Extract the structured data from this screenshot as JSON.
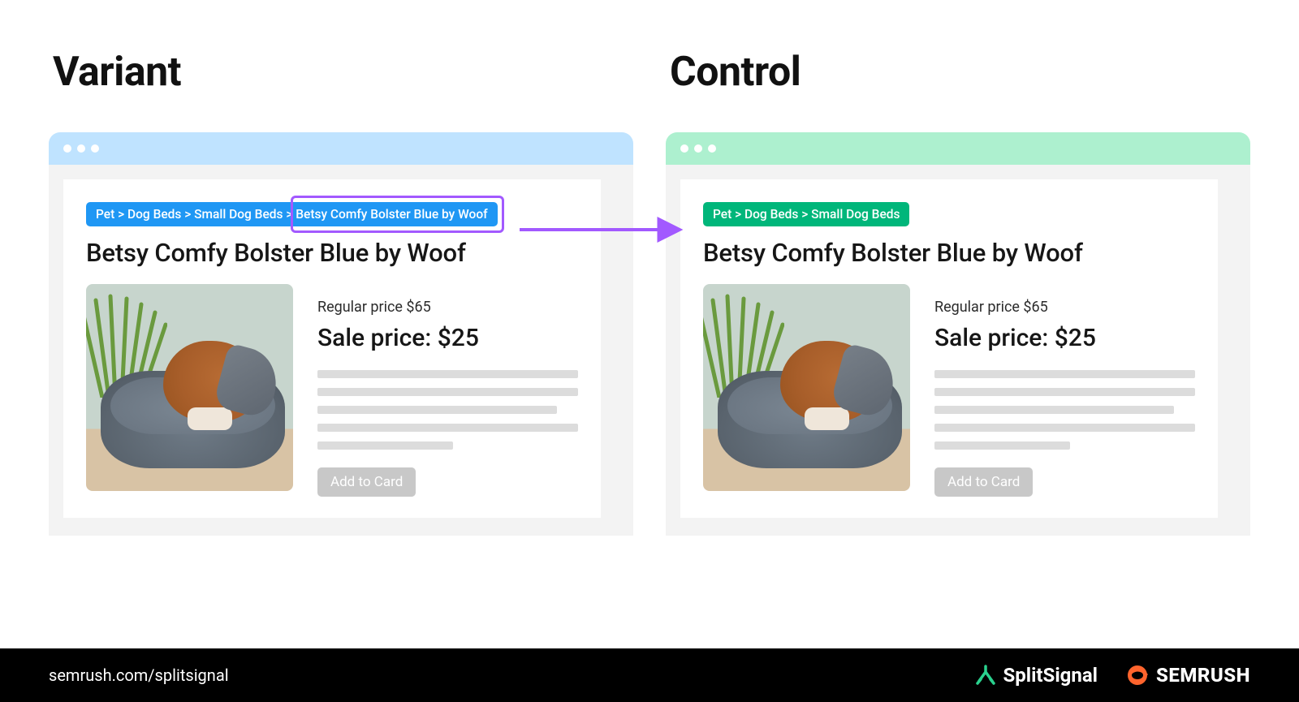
{
  "headings": {
    "variant": "Variant",
    "control": "Control"
  },
  "variant": {
    "breadcrumb": "Pet > Dog Beds > Small Dog Beds  > Betsy Comfy Bolster Blue by Woof",
    "product_title": "Betsy Comfy Bolster Blue by Woof",
    "regular_price": "Regular price $65",
    "sale_price": "Sale price: $25",
    "button": "Add to Card"
  },
  "control": {
    "breadcrumb": "Pet > Dog Beds > Small Dog Beds",
    "product_title": "Betsy Comfy Bolster Blue by Woof",
    "regular_price": "Regular price $65",
    "sale_price": "Sale price: $25",
    "button": "Add to Card"
  },
  "footer": {
    "url": "semrush.com/splitsignal",
    "brand1": "SplitSignal",
    "brand2": "SEMRUSH"
  },
  "colors": {
    "variant_bar": "#bfe3ff",
    "control_bar": "#adf0cf",
    "variant_crumb": "#1f97f4",
    "control_crumb": "#00b67a",
    "highlight": "#a259ff",
    "semrush_orange": "#ff642d"
  }
}
